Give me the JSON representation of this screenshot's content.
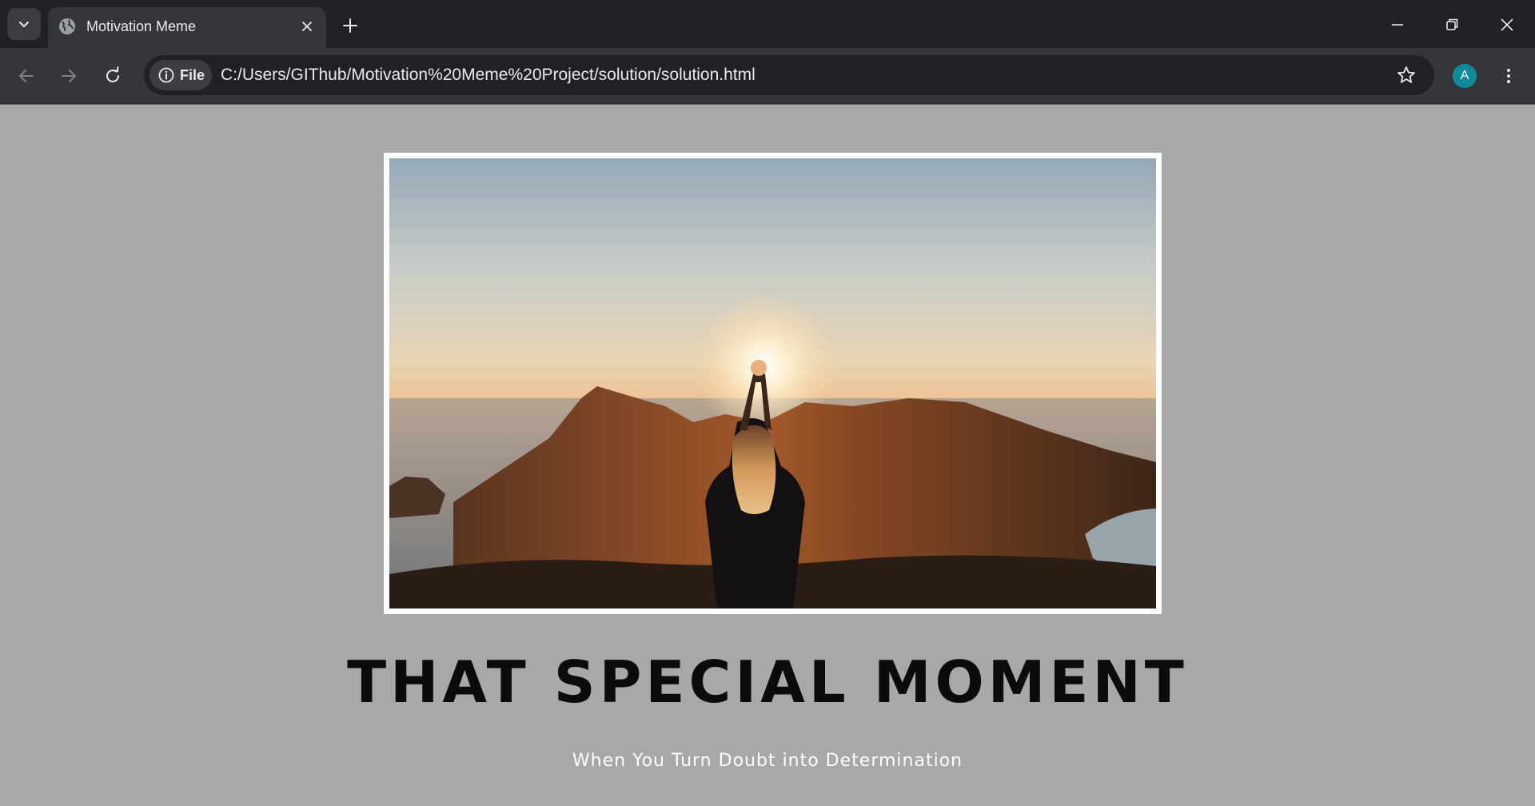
{
  "browser": {
    "tab": {
      "title": "Motivation Meme",
      "favicon": "globe-icon"
    },
    "site_chip_label": "File",
    "url": "C:/Users/GIThub/Motivation%20Meme%20Project/solution/solution.html",
    "profile_initial": "A",
    "colors": {
      "tabstrip": "#202124",
      "toolbar": "#35363a",
      "avatar": "#0e8a9a"
    }
  },
  "page": {
    "background": "#a8a8a8",
    "image": {
      "description_icon": "sunset-photo",
      "frame_color": "#ffffff"
    },
    "headline": "THAT SPECIAL MOMENT",
    "subtitle": "When You Turn Doubt into Determination"
  }
}
